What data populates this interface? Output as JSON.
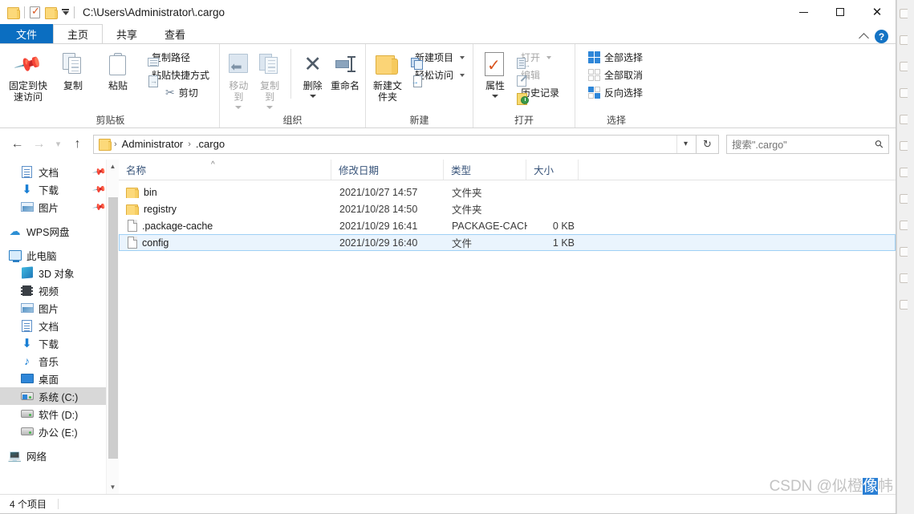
{
  "window": {
    "title_path": "C:\\Users\\Administrator\\.cargo",
    "minimize_label": "—",
    "maximize_label": "□",
    "close_label": "✕"
  },
  "quick_access": {
    "folder_icon": "folder-icon",
    "properties_icon": "properties-icon",
    "new_folder_icon": "new-folder-icon",
    "dropdown_icon": "chevron-down-icon"
  },
  "tabs": [
    {
      "label": "文件",
      "kind": "file"
    },
    {
      "label": "主页",
      "kind": "active"
    },
    {
      "label": "共享",
      "kind": "normal"
    },
    {
      "label": "查看",
      "kind": "normal"
    }
  ],
  "ribbon_right": {
    "collapse_icon": "chevron-up-icon",
    "help_label": "?"
  },
  "ribbon": {
    "groups": [
      {
        "name": "clipboard",
        "label": "剪贴板",
        "big": [
          {
            "label": "固定到快速访问",
            "icon": "pin-icon"
          },
          {
            "label": "复制",
            "icon": "copy-icon"
          },
          {
            "label": "粘贴",
            "icon": "paste-icon"
          }
        ],
        "small": [
          {
            "label": "复制路径",
            "icon": "copy-path-icon"
          },
          {
            "label": "粘贴快捷方式",
            "icon": "paste-shortcut-icon"
          },
          {
            "label": "剪切",
            "icon": "scissors-icon"
          }
        ]
      },
      {
        "name": "organize",
        "label": "组织",
        "big": [
          {
            "label": "移动到",
            "icon": "move-to-icon",
            "disabled": true,
            "caret": true
          },
          {
            "label": "复制到",
            "icon": "copy-to-icon",
            "disabled": true,
            "caret": true
          },
          {
            "label": "删除",
            "icon": "delete-icon",
            "caret": true
          },
          {
            "label": "重命名",
            "icon": "rename-icon"
          }
        ]
      },
      {
        "name": "new",
        "label": "新建",
        "big": [
          {
            "label": "新建文件夹",
            "icon": "new-folder-icon"
          }
        ],
        "small": [
          {
            "label": "新建项目",
            "icon": "new-item-icon",
            "caret": true
          },
          {
            "label": "轻松访问",
            "icon": "easy-access-icon",
            "caret": true
          }
        ]
      },
      {
        "name": "open",
        "label": "打开",
        "big": [
          {
            "label": "属性",
            "icon": "properties-icon",
            "caret": true
          }
        ],
        "small": [
          {
            "label": "打开",
            "icon": "open-icon",
            "disabled": true,
            "caret": true
          },
          {
            "label": "编辑",
            "icon": "edit-icon",
            "disabled": true
          },
          {
            "label": "历史记录",
            "icon": "history-icon"
          }
        ]
      },
      {
        "name": "select",
        "label": "选择",
        "small": [
          {
            "label": "全部选择",
            "icon": "select-all-icon"
          },
          {
            "label": "全部取消",
            "icon": "select-none-icon"
          },
          {
            "label": "反向选择",
            "icon": "invert-selection-icon"
          }
        ]
      }
    ]
  },
  "nav": {
    "back_icon": "arrow-left-icon",
    "forward_icon": "arrow-right-icon",
    "recent_icon": "chevron-down-icon",
    "up_icon": "arrow-up-icon",
    "breadcrumbs": [
      "Administrator",
      ".cargo"
    ],
    "address_dropdown_icon": "chevron-down-icon",
    "refresh_icon": "refresh-icon"
  },
  "search": {
    "placeholder": "搜索\".cargo\"",
    "value": "",
    "icon": "search-icon"
  },
  "sidebar": {
    "items": [
      {
        "label": "文档",
        "icon": "documents-icon",
        "indent": 1,
        "pinned": true
      },
      {
        "label": "下载",
        "icon": "downloads-icon",
        "indent": 1,
        "pinned": true
      },
      {
        "label": "图片",
        "icon": "pictures-icon",
        "indent": 1,
        "pinned": true
      },
      {
        "label": "WPS网盘",
        "icon": "cloud-icon",
        "indent": 0,
        "gap_before": true
      },
      {
        "label": "此电脑",
        "icon": "this-pc-icon",
        "indent": 0,
        "gap_before": true
      },
      {
        "label": "3D 对象",
        "icon": "3d-objects-icon",
        "indent": 1
      },
      {
        "label": "视频",
        "icon": "videos-icon",
        "indent": 1
      },
      {
        "label": "图片",
        "icon": "pictures-icon",
        "indent": 1
      },
      {
        "label": "文档",
        "icon": "documents-icon",
        "indent": 1
      },
      {
        "label": "下载",
        "icon": "downloads-icon",
        "indent": 1
      },
      {
        "label": "音乐",
        "icon": "music-icon",
        "indent": 1
      },
      {
        "label": "桌面",
        "icon": "desktop-icon",
        "indent": 1
      },
      {
        "label": "系统 (C:)",
        "icon": "system-drive-icon",
        "indent": 1,
        "selected": true
      },
      {
        "label": "软件 (D:)",
        "icon": "drive-icon",
        "indent": 1
      },
      {
        "label": "办公 (E:)",
        "icon": "drive-icon",
        "indent": 1
      },
      {
        "label": "网络",
        "icon": "network-icon",
        "indent": 0,
        "gap_before": true
      }
    ],
    "scroll_up_icon": "chevron-up-icon",
    "scroll_down_icon": "chevron-down-icon"
  },
  "file_list": {
    "columns": [
      {
        "key": "name",
        "label": "名称",
        "sorted": true,
        "sort_icon": "chevron-up-icon"
      },
      {
        "key": "date",
        "label": "修改日期"
      },
      {
        "key": "type",
        "label": "类型"
      },
      {
        "key": "size",
        "label": "大小"
      }
    ],
    "rows": [
      {
        "name": "bin",
        "date": "2021/10/27 14:57",
        "type": "文件夹",
        "size": "",
        "icon": "folder-icon",
        "selected": false
      },
      {
        "name": "registry",
        "date": "2021/10/28 14:50",
        "type": "文件夹",
        "size": "",
        "icon": "folder-icon",
        "selected": false
      },
      {
        "name": ".package-cache",
        "date": "2021/10/29 16:41",
        "type": "PACKAGE-CACH...",
        "size": "0 KB",
        "icon": "file-icon",
        "selected": false
      },
      {
        "name": "config",
        "date": "2021/10/29 16:40",
        "type": "文件",
        "size": "1 KB",
        "icon": "file-icon",
        "selected": true
      }
    ]
  },
  "status": {
    "item_count": "4 个项目"
  },
  "watermark": {
    "prefix": "CSDN @似橙",
    "highlight": "像",
    "suffix": "帏"
  },
  "colors": {
    "file_tab_blue": "#0b6ec1",
    "selection_blue": "#eaf4fd",
    "selection_border": "#9fd0f5",
    "folder_yellow": "#fcd97a",
    "accent_blue": "#2e86d8",
    "header_text": "#38547a"
  }
}
